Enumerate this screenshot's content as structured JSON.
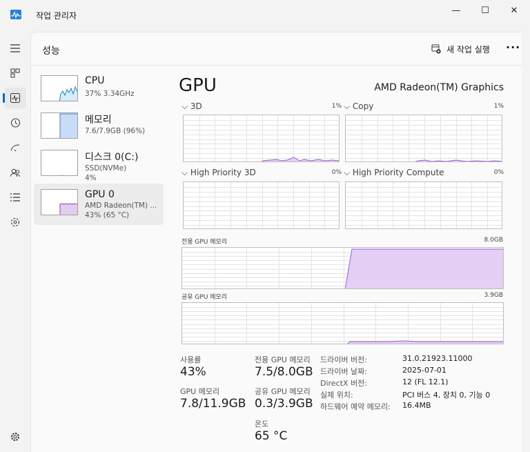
{
  "window": {
    "title": "작업 관리자",
    "minimize": "—",
    "maximize": "☐",
    "close": "✕"
  },
  "header": {
    "title": "성능",
    "run_task_label": "새 작업 실행",
    "more": "···"
  },
  "nav": [
    {
      "name": "hamburger-icon"
    },
    {
      "name": "processes-icon"
    },
    {
      "name": "performance-icon"
    },
    {
      "name": "app-history-icon"
    },
    {
      "name": "startup-apps-icon"
    },
    {
      "name": "users-icon"
    },
    {
      "name": "details-icon"
    },
    {
      "name": "services-icon"
    },
    {
      "name": "settings-icon"
    }
  ],
  "devices": [
    {
      "name": "CPU",
      "sub1": "37% 3.34GHz",
      "sub2": "",
      "color": "#1482c8"
    },
    {
      "name": "메모리",
      "sub1": "7.6/7.9GB (96%)",
      "sub2": "",
      "color": "#3c78d8"
    },
    {
      "name": "디스크 0(C:)",
      "sub1": "SSD(NVMe)",
      "sub2": "4%",
      "color": "#4f9b2f"
    },
    {
      "name": "GPU 0",
      "sub1": "AMD Radeon(TM) ...",
      "sub2": "43% (65 °C)",
      "color": "#8e44ad"
    }
  ],
  "gpu": {
    "title": "GPU",
    "model": "AMD Radeon(TM) Graphics",
    "engines": [
      {
        "label": "3D",
        "value": "1%"
      },
      {
        "label": "Copy",
        "value": "1%"
      },
      {
        "label": "High Priority 3D",
        "value": "0%"
      },
      {
        "label": "High Priority Compute",
        "value": "0%"
      }
    ],
    "dedicated_label": "전용 GPU 메모리",
    "dedicated_max": "8.0GB",
    "shared_label": "공유 GPU 메모리",
    "shared_max": "3.9GB"
  },
  "stats": {
    "usage_label": "사용률",
    "usage_value": "43%",
    "dedicated_label": "전용 GPU 메모리",
    "dedicated_value": "7.5/8.0GB",
    "gpumem_label": "GPU 메모리",
    "gpumem_value": "7.8/11.9GB",
    "shared_label": "공유 GPU 메모리",
    "shared_value": "0.3/3.9GB",
    "temp_label": "온도",
    "temp_value": "65 °C"
  },
  "info": [
    {
      "key": "드라이버 버전:",
      "value": "31.0.21923.11000"
    },
    {
      "key": "드라이버 날짜:",
      "value": "2025-07-01"
    },
    {
      "key": "DirectX 버전:",
      "value": "12 (FL 12.1)"
    },
    {
      "key": "실제 위치:",
      "value": "PCI 버스 4, 장치 0, 기능 0"
    },
    {
      "key": "하드웨어 예약 메모리:",
      "value": "16.4MB"
    }
  ]
}
